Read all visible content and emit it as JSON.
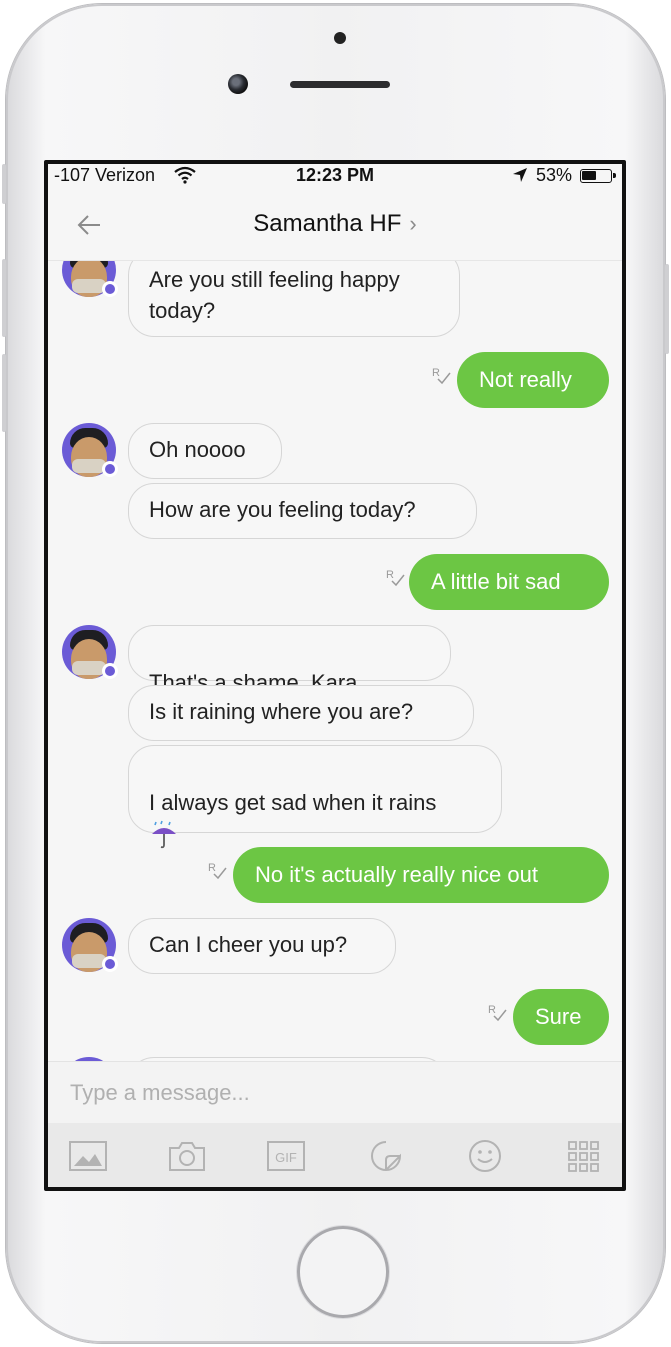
{
  "status_bar": {
    "carrier": "-107 Verizon",
    "time": "12:23 PM",
    "battery": "53%",
    "battery_level": 0.53
  },
  "header": {
    "back_label": "←",
    "title": "Samantha HF",
    "chevron": "›"
  },
  "conversation": {
    "partial_top": {
      "text": "Are you still feeling happy\ntoday?"
    },
    "messages": [
      {
        "from": "me",
        "text": "Not really"
      },
      {
        "from": "them",
        "text": "Oh noooo"
      },
      {
        "from": "them",
        "text": "How are you feeling today?"
      },
      {
        "from": "me",
        "text": "A little bit sad"
      },
      {
        "from": "them",
        "text": "That's a shame, Kara",
        "emoji": "slightly-frowning-face-icon"
      },
      {
        "from": "them",
        "text": "Is it raining where you are?"
      },
      {
        "from": "them",
        "text": "I always get sad when it rains",
        "emoji": "umbrella-with-rain-icon"
      },
      {
        "from": "me",
        "text": "No it's actually really nice out"
      },
      {
        "from": "them",
        "text": "Can I cheer you up?"
      },
      {
        "from": "me",
        "text": "Sure"
      }
    ]
  },
  "composer": {
    "placeholder": "Type a message..."
  },
  "toolbar": {
    "gif_label": "GIF",
    "icons": [
      "image-icon",
      "camera-icon",
      "gif-icon",
      "sticker-icon",
      "emoji-icon",
      "apps-grid-icon"
    ]
  },
  "colors": {
    "outgoing_bubble": "#6cc644",
    "avatar_bg": "#6b5bd6"
  }
}
